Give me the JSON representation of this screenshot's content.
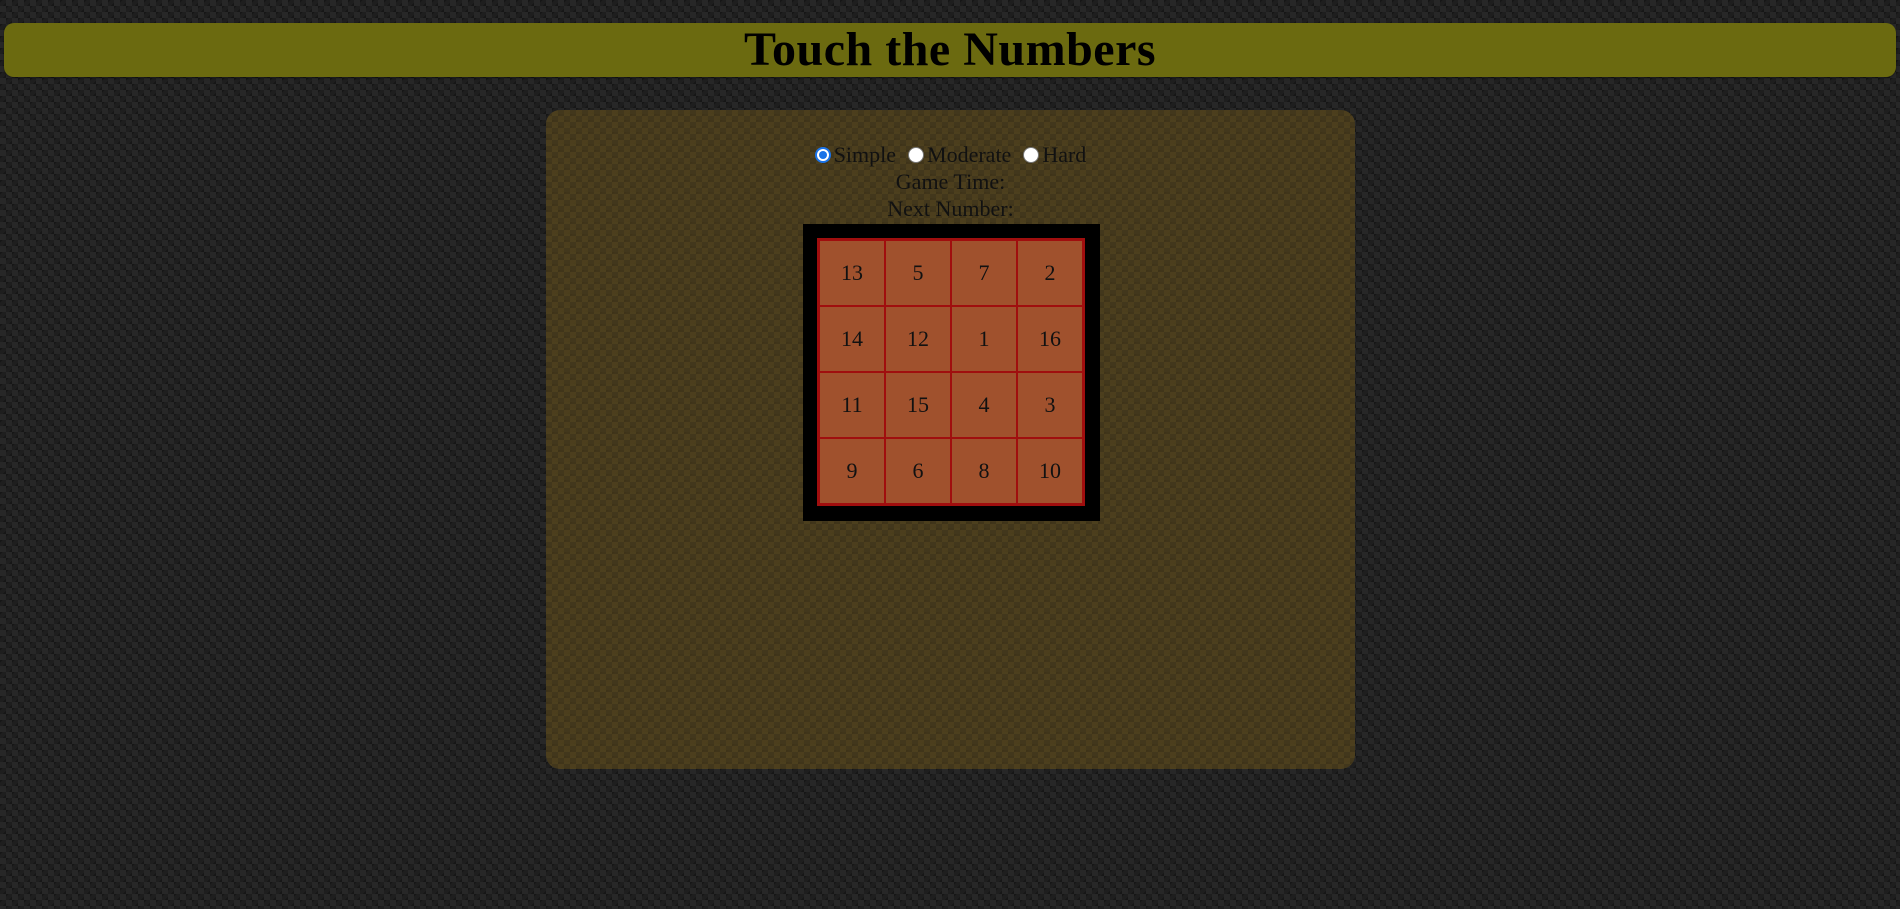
{
  "header": {
    "title": "Touch the Numbers"
  },
  "difficulty": {
    "options": [
      {
        "label": "Simple",
        "checked": true
      },
      {
        "label": "Moderate",
        "checked": false
      },
      {
        "label": "Hard",
        "checked": false
      }
    ]
  },
  "status": {
    "game_time_label": "Game Time:",
    "next_number_label": "Next Number:"
  },
  "board": {
    "rows": 4,
    "cols": 4,
    "cells": [
      "13",
      "5",
      "7",
      "2",
      "14",
      "12",
      "1",
      "16",
      "11",
      "15",
      "4",
      "3",
      "9",
      "6",
      "8",
      "10"
    ]
  },
  "colors": {
    "title_bar": "#6b6a10",
    "cell_fill": "#a0512d",
    "cell_border": "#a00e0e",
    "board_frame": "#000000",
    "radio_accent": "#1a73e8"
  }
}
